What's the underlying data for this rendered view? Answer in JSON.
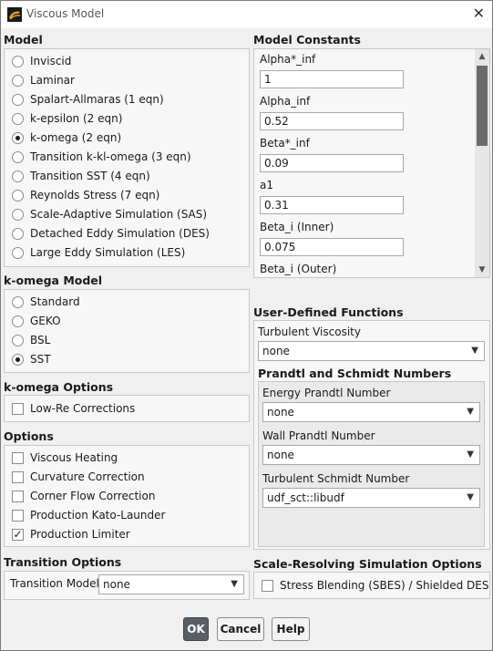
{
  "window": {
    "title": "Viscous Model",
    "close_icon": "close-icon"
  },
  "model": {
    "title": "Model",
    "options": [
      {
        "label": "Inviscid",
        "selected": false
      },
      {
        "label": "Laminar",
        "selected": false
      },
      {
        "label": "Spalart-Allmaras (1 eqn)",
        "selected": false
      },
      {
        "label": "k-epsilon (2 eqn)",
        "selected": false
      },
      {
        "label": "k-omega (2 eqn)",
        "selected": true
      },
      {
        "label": "Transition k-kl-omega (3 eqn)",
        "selected": false
      },
      {
        "label": "Transition SST (4 eqn)",
        "selected": false
      },
      {
        "label": "Reynolds Stress (7 eqn)",
        "selected": false
      },
      {
        "label": "Scale-Adaptive Simulation (SAS)",
        "selected": false
      },
      {
        "label": "Detached Eddy Simulation (DES)",
        "selected": false
      },
      {
        "label": "Large Eddy Simulation (LES)",
        "selected": false
      }
    ]
  },
  "komega_model": {
    "title": "k-omega Model",
    "options": [
      {
        "label": "Standard",
        "selected": false
      },
      {
        "label": "GEKO",
        "selected": false
      },
      {
        "label": "BSL",
        "selected": false
      },
      {
        "label": "SST",
        "selected": true
      }
    ]
  },
  "komega_options": {
    "title": "k-omega Options",
    "items": [
      {
        "label": "Low-Re Corrections",
        "checked": false
      }
    ]
  },
  "options": {
    "title": "Options",
    "items": [
      {
        "label": "Viscous Heating",
        "checked": false
      },
      {
        "label": "Curvature Correction",
        "checked": false
      },
      {
        "label": "Corner Flow Correction",
        "checked": false
      },
      {
        "label": "Production Kato-Launder",
        "checked": false
      },
      {
        "label": "Production Limiter",
        "checked": true
      }
    ]
  },
  "transition_options": {
    "title": "Transition Options",
    "label": "Transition Model",
    "value": "none"
  },
  "model_constants": {
    "title": "Model Constants",
    "items": [
      {
        "label": "Alpha*_inf",
        "value": "1"
      },
      {
        "label": "Alpha_inf",
        "value": "0.52"
      },
      {
        "label": "Beta*_inf",
        "value": "0.09"
      },
      {
        "label": "a1",
        "value": "0.31"
      },
      {
        "label": "Beta_i (Inner)",
        "value": "0.075"
      },
      {
        "label": "Beta_i (Outer)",
        "value": ""
      }
    ]
  },
  "udf": {
    "title": "User-Defined Functions",
    "turbulent_viscosity": {
      "label": "Turbulent Viscosity",
      "value": "none"
    },
    "prandtl_title": "Prandtl and Schmidt Numbers",
    "energy_prandtl": {
      "label": "Energy Prandtl Number",
      "value": "none"
    },
    "wall_prandtl": {
      "label": "Wall Prandtl Number",
      "value": "none"
    },
    "turbulent_schmidt": {
      "label": "Turbulent Schmidt Number",
      "value": "udf_sct::libudf"
    }
  },
  "srs_options": {
    "title": "Scale-Resolving Simulation Options",
    "items": [
      {
        "label": "Stress Blending (SBES) / Shielded DES",
        "checked": false
      }
    ]
  },
  "buttons": {
    "ok": "OK",
    "cancel": "Cancel",
    "help": "Help"
  }
}
